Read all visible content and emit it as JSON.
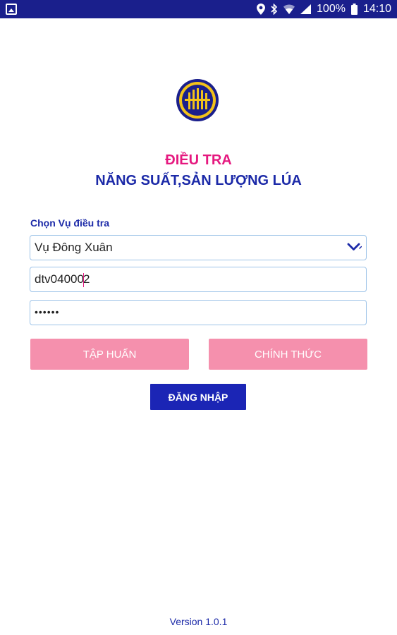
{
  "status_bar": {
    "battery_percent": "100%",
    "time": "14:10",
    "icons": [
      "image-icon",
      "location-icon",
      "bluetooth-icon",
      "wifi-icon",
      "signal-icon",
      "battery-icon"
    ]
  },
  "header": {
    "title_line1": "ĐIỀU TRA",
    "title_line2": "NĂNG SUẤT,SẢN LƯỢNG LÚA"
  },
  "form": {
    "season_label": "Chọn Vụ điều tra",
    "season_selected": "Vụ Đông Xuân",
    "username_before_caret": "dtv04000",
    "username_after_caret": "2",
    "password_masked": "••••••"
  },
  "buttons": {
    "training": "TẬP HUẤN",
    "official": "CHÍNH THỨC",
    "login": "ĐĂNG NHẬP"
  },
  "footer": {
    "version": "Version 1.0.1"
  },
  "colors": {
    "status_bar": "#1a1f8c",
    "title_pink": "#e5187f",
    "title_blue": "#1c2aa8",
    "pink_button": "#f590ad",
    "login_button": "#1b25b5",
    "field_border": "#9dc3e8"
  }
}
